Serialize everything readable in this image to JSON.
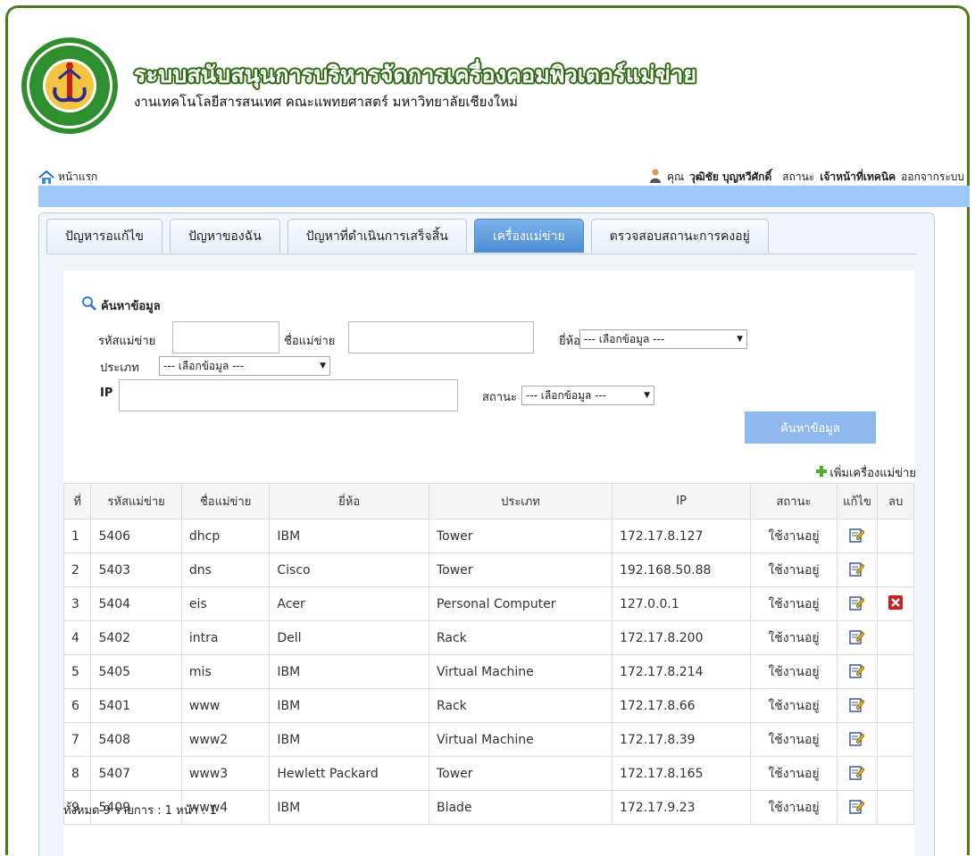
{
  "header": {
    "title": "ระบบสนับสนุนการบริหารจัดการเครื่องคอมพิวเตอร์แม่ข่าย",
    "subtitle": "งานเทคโนโลยีสารสนเทศ คณะแพทยศาสตร์ มหาวิทยาลัยเชียงใหม่",
    "logo_icon": "university-seal-logo"
  },
  "topbar": {
    "home_label": "หน้าแรก",
    "user_prefix": "คุณ",
    "user_name": "วุฒิชัย บุญหวีศักดิ์",
    "status_prefix": "สถานะ",
    "status_value": "เจ้าหน้าที่เทคนิค",
    "logout_label": "ออกจากระบบ"
  },
  "tabs": [
    {
      "label": "ปัญหารอแก้ไข",
      "active": false
    },
    {
      "label": "ปัญหาของฉัน",
      "active": false
    },
    {
      "label": "ปัญหาที่ดำเนินการเสร็จสิ้น",
      "active": false
    },
    {
      "label": "เครื่องแม่ข่าย",
      "active": true
    },
    {
      "label": "ตรวจสอบสถานะการคงอยู่",
      "active": false
    }
  ],
  "search": {
    "heading": "ค้นหาข้อมูล",
    "server_code_label": "รหัสแม่ข่าย",
    "server_name_label": "ชื่อแม่ข่าย",
    "brand_label": "ยี่ห้อ",
    "brand_value": "--- เลือกข้อมูล ---",
    "type_label": "ประเภท",
    "type_value": "--- เลือกข้อมูล ---",
    "ip_label": "IP",
    "status_label": "สถานะ",
    "status_value": "--- เลือกข้อมูล ---",
    "search_button": "ค้นหาข้อมูล"
  },
  "add_server_label": "เพิ่มเครื่องแม่ข่าย",
  "table": {
    "columns": [
      "ที่",
      "รหัสแม่ข่าย",
      "ชื่อแม่ข่าย",
      "ยี่ห้อ",
      "ประเภท",
      "IP",
      "สถานะ",
      "แก้ไข",
      "ลบ"
    ],
    "rows": [
      {
        "no": "1",
        "code": "5406",
        "name": "dhcp",
        "brand": "IBM",
        "type": "Tower",
        "ip": "172.17.8.127",
        "status": "ใช้งานอยู่",
        "deletable": false
      },
      {
        "no": "2",
        "code": "5403",
        "name": "dns",
        "brand": "Cisco",
        "type": "Tower",
        "ip": "192.168.50.88",
        "status": "ใช้งานอยู่",
        "deletable": false
      },
      {
        "no": "3",
        "code": "5404",
        "name": "eis",
        "brand": "Acer",
        "type": "Personal Computer",
        "ip": "127.0.0.1",
        "status": "ใช้งานอยู่",
        "deletable": true
      },
      {
        "no": "4",
        "code": "5402",
        "name": "intra",
        "brand": "Dell",
        "type": "Rack",
        "ip": "172.17.8.200",
        "status": "ใช้งานอยู่",
        "deletable": false
      },
      {
        "no": "5",
        "code": "5405",
        "name": "mis",
        "brand": "IBM",
        "type": "Virtual Machine",
        "ip": "172.17.8.214",
        "status": "ใช้งานอยู่",
        "deletable": false
      },
      {
        "no": "6",
        "code": "5401",
        "name": "www",
        "brand": "IBM",
        "type": "Rack",
        "ip": "172.17.8.66",
        "status": "ใช้งานอยู่",
        "deletable": false
      },
      {
        "no": "7",
        "code": "5408",
        "name": "www2",
        "brand": "IBM",
        "type": "Virtual Machine",
        "ip": "172.17.8.39",
        "status": "ใช้งานอยู่",
        "deletable": false
      },
      {
        "no": "8",
        "code": "5407",
        "name": "www3",
        "brand": "Hewlett Packard",
        "type": "Tower",
        "ip": "172.17.8.165",
        "status": "ใช้งานอยู่",
        "deletable": false
      },
      {
        "no": "9",
        "code": "5409",
        "name": "www4",
        "brand": "IBM",
        "type": "Blade",
        "ip": "172.17.9.23",
        "status": "ใช้งานอยู่",
        "deletable": false
      }
    ]
  },
  "footer": "ทั้งหมด 9 รายการ : 1 หน้า : 1",
  "colors": {
    "brand_green": "#2e6b12",
    "status_green": "#88c63a",
    "active_tab": "#4a8cd6",
    "banner_blue": "#9dc8f7",
    "delete_red": "#c8201e"
  }
}
